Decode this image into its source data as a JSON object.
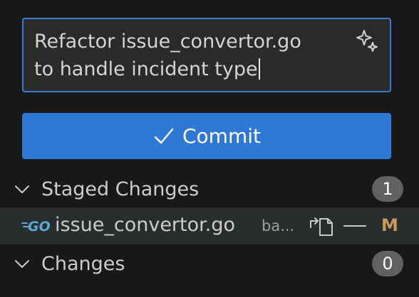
{
  "commit_message": {
    "value": "Refactor issue_convertor.go\nto handle incident type",
    "generate_icon": "sparkle-icon"
  },
  "commit_button": {
    "label": "Commit",
    "icon": "check-icon",
    "color": "#2f78d6"
  },
  "staged_changes": {
    "label": "Staged Changes",
    "count": "1",
    "expanded": true,
    "files": [
      {
        "name": "issue_convertor.go",
        "directory": "ba...",
        "status": "M",
        "icon": "go-file-icon",
        "actions": [
          "open-file-icon",
          "unstage-icon"
        ]
      }
    ]
  },
  "changes": {
    "label": "Changes",
    "count": "0",
    "expanded": true
  },
  "colors": {
    "background": "#181818",
    "accent": "#3a7bd5",
    "modified": "#c89a5e",
    "selected_row": "#2a2d2e"
  }
}
